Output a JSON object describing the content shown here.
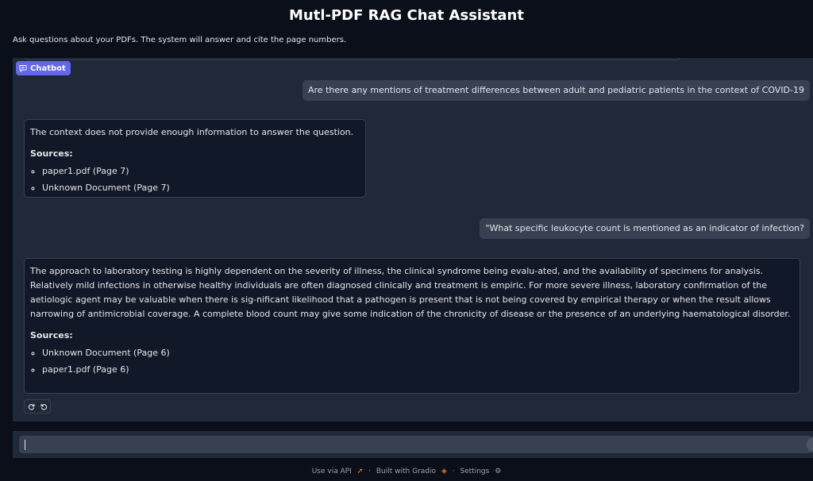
{
  "header": {
    "title": "Mutl-PDF RAG Chat Assistant",
    "subtitle": "Ask questions about your PDFs. The system will answer and cite the page numbers."
  },
  "chatbot": {
    "label": "Chatbot",
    "messages": [
      {
        "role": "user",
        "text": "Are there any mentions of treatment differences between adult and pediatric patients in the context of COVID-19"
      },
      {
        "role": "assistant",
        "text": "The context does not provide enough information to answer the question.",
        "sources_heading": "Sources:",
        "sources": [
          "paper1.pdf (Page 7)",
          "Unknown Document (Page 7)"
        ]
      },
      {
        "role": "user",
        "text": "\"What specific leukocyte count is mentioned as an indicator of infection?"
      },
      {
        "role": "assistant",
        "text": "The approach to laboratory testing is highly dependent on the severity of illness, the clinical syndrome being evalu-ated, and the availability of specimens for analysis. Relatively mild infections in otherwise healthy individuals are often diagnosed clinically and treatment is empiric. For more severe illness, laboratory confirmation of the aetiologic agent may be valuable when there is sig-nificant likelihood that a pathogen is present that is not being covered by empirical therapy or when the result allows narrowing of antimicrobial coverage. A complete blood count may give some indication of the chronicity of disease or the presence of an underlying haematological disorder.",
        "sources_heading": "Sources:",
        "sources": [
          "Unknown Document (Page 6)",
          "paper1.pdf (Page 6)"
        ]
      }
    ],
    "action_icons": [
      "retry-icon",
      "undo-icon"
    ]
  },
  "input": {
    "value": "",
    "placeholder": ""
  },
  "footer": {
    "api_label": "Use via API",
    "separator": "·",
    "built_label": "Built with Gradio",
    "settings_label": "Settings"
  },
  "colors": {
    "background": "#0b0f19",
    "panel": "#1f2937",
    "accent": "#6366f1"
  }
}
